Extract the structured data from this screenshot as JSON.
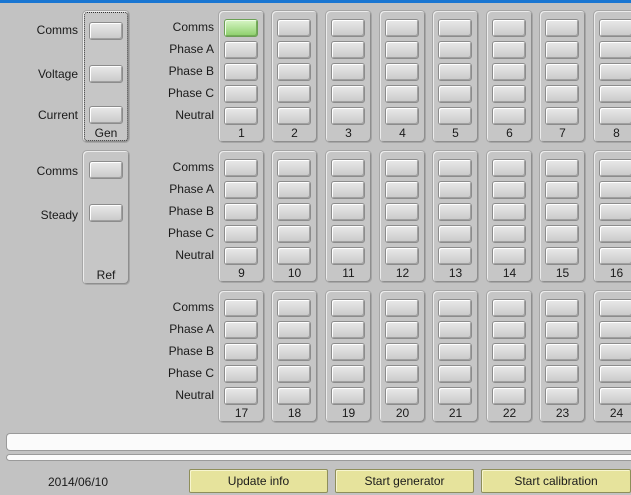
{
  "generator": {
    "labels": [
      "Comms",
      "Voltage",
      "Current"
    ],
    "caption": "Gen"
  },
  "reference": {
    "labels": [
      "Comms",
      "Steady"
    ],
    "caption": "Ref"
  },
  "channel_rows": [
    "Comms",
    "Phase A",
    "Phase B",
    "Phase C",
    "Neutral"
  ],
  "groups": [
    {
      "channels": [
        "1",
        "2",
        "3",
        "4",
        "5",
        "6",
        "7",
        "8"
      ]
    },
    {
      "channels": [
        "9",
        "10",
        "11",
        "12",
        "13",
        "14",
        "15",
        "16"
      ]
    },
    {
      "channels": [
        "17",
        "18",
        "19",
        "20",
        "21",
        "22",
        "23",
        "24"
      ]
    }
  ],
  "active_indicator": {
    "channel": "1",
    "row": "Comms",
    "color": "#8ccf6a"
  },
  "status": {
    "date": "2014/06/10"
  },
  "buttons": {
    "update": "Update info",
    "start_generator": "Start generator",
    "start_calibration": "Start calibration"
  }
}
